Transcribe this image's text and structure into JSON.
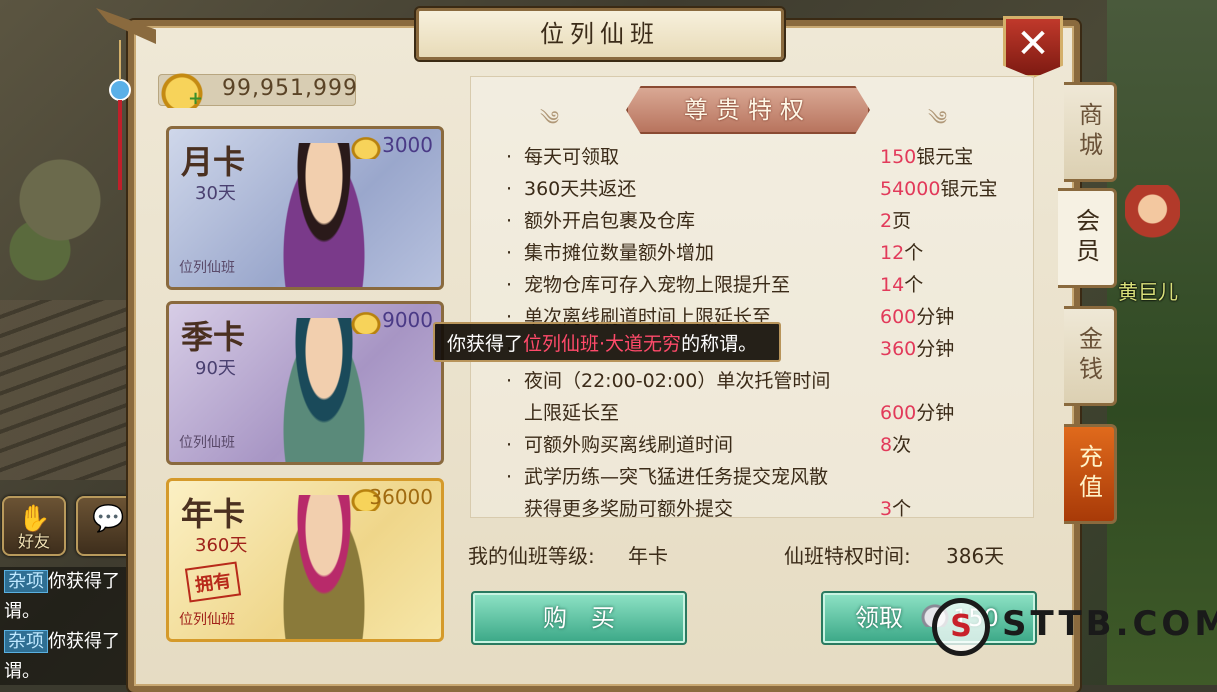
{
  "window": {
    "title": "位列仙班",
    "close_icon": "close-icon"
  },
  "currency": {
    "value": "99,951,999",
    "icon": "gold-ingot-icon"
  },
  "cards": [
    {
      "name": "月卡",
      "days": "30天",
      "price": "3000",
      "footer": "位列仙班"
    },
    {
      "name": "季卡",
      "days": "90天",
      "price": "9000",
      "footer": "位列仙班"
    },
    {
      "name": "年卡",
      "days": "360天",
      "price": "36000",
      "footer": "位列仙班",
      "owned": "拥有"
    }
  ],
  "tabs": [
    {
      "label": "商城",
      "active": false
    },
    {
      "label": "会员",
      "active": true
    },
    {
      "label": "金钱",
      "active": false
    },
    {
      "label": "充值",
      "active": false
    }
  ],
  "privilege": {
    "title": "尊贵特权",
    "rows": [
      {
        "text": "每天可领取",
        "num": "150",
        "unit": "银元宝"
      },
      {
        "text": "360天共返还",
        "num": "54000",
        "unit": "银元宝"
      },
      {
        "text": "额外开启包裹及仓库",
        "num": "2",
        "unit": "页"
      },
      {
        "text": "集市摊位数量额外增加",
        "num": "12",
        "unit": "个"
      },
      {
        "text": "宠物仓库可存入宠物上限提升至",
        "num": "14",
        "unit": "个"
      },
      {
        "text": "单次离线刷道时间上限延长至",
        "num": "600",
        "unit": "分钟"
      },
      {
        "text": "",
        "num": "360",
        "unit": "分钟"
      },
      {
        "text": "夜间（22:00-02:00）单次托管时间",
        "num": "",
        "unit": ""
      },
      {
        "text": "上限延长至",
        "num": "600",
        "unit": "分钟",
        "no_dot": true
      },
      {
        "text": "可额外购买离线刷道时间",
        "num": "8",
        "unit": "次"
      },
      {
        "text": "武学历练—突飞猛进任务提交宠风散",
        "num": "",
        "unit": ""
      },
      {
        "text": "获得更多奖励可额外提交",
        "num": "3",
        "unit": "个",
        "no_dot": true
      }
    ]
  },
  "tooltip": {
    "prefix": "你获得了",
    "highlight": "位列仙班·大道无穷",
    "suffix": "的称谓。"
  },
  "status": {
    "level_label": "我的仙班等级:",
    "level_value": "年卡",
    "time_label": "仙班特权时间:",
    "time_value": "386天"
  },
  "buttons": {
    "buy": "购　买",
    "claim": "领取",
    "claim_amount": "150"
  },
  "hud": {
    "friends": "好友"
  },
  "chat": [
    {
      "tag": "杂项",
      "text": "你获得了"
    },
    {
      "tag": "",
      "text": "谓。"
    },
    {
      "tag": "杂项",
      "text": "你获得了"
    },
    {
      "tag": "",
      "text": "谓。"
    }
  ],
  "npc": {
    "name": "黄巨儿"
  },
  "watermark": {
    "text": "STTB.COM"
  }
}
